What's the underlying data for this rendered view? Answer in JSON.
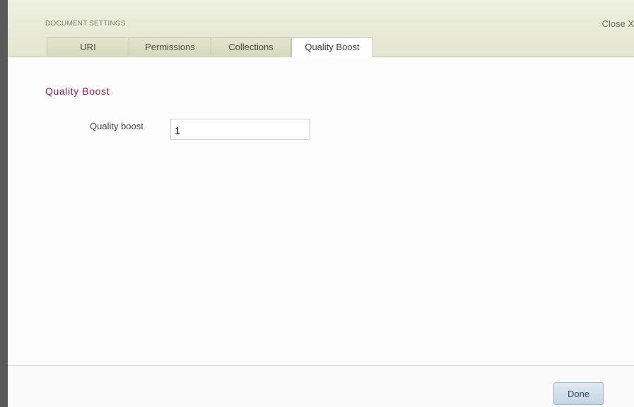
{
  "dialog": {
    "title": "DOCUMENT SETTINGS",
    "close_label": "Close X"
  },
  "tabs": [
    {
      "label": "URI",
      "active": false
    },
    {
      "label": "Permissions",
      "active": false
    },
    {
      "label": "Collections",
      "active": false
    },
    {
      "label": "Quality Boost",
      "active": true
    }
  ],
  "section": {
    "title": "Quality Boost"
  },
  "quality_field": {
    "label": "Quality boost",
    "value": "1"
  },
  "footer": {
    "done_label": "Done"
  },
  "colors": {
    "header_bg": "#e3e6d0",
    "section_title": "#9c1a4a",
    "done_button_bg": "#c5d5e3",
    "left_border": "#595959"
  }
}
